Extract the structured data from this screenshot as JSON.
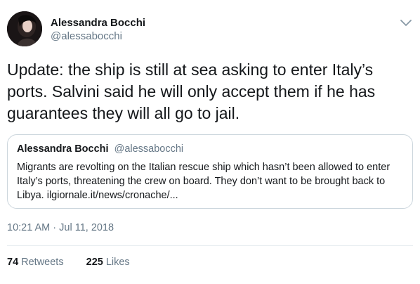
{
  "author": {
    "name": "Alessandra Bocchi",
    "handle": "@alessabocchi"
  },
  "tweet": {
    "text": "Update: the ship is still at sea asking to enter Italy’s ports. Salvini said he will only accept them if he has guarantees they will all go to jail.",
    "timestamp": "10:21 AM · Jul 11, 2018"
  },
  "quote": {
    "name": "Alessandra Bocchi",
    "handle": "@alessabocchi",
    "text": "Migrants are revolting on the Italian rescue ship which hasn’t been allowed to enter Italy’s ports, threatening the crew on board. They don’t want to be brought back to Libya. ilgiornale.it/news/cronache/..."
  },
  "stats": {
    "retweets_count": "74",
    "retweets_label": "Retweets",
    "likes_count": "225",
    "likes_label": "Likes"
  },
  "icons": {
    "menu": "chevron-down-icon"
  },
  "colors": {
    "text": "#14171a",
    "secondary": "#657786",
    "border": "#ccd6dd"
  }
}
